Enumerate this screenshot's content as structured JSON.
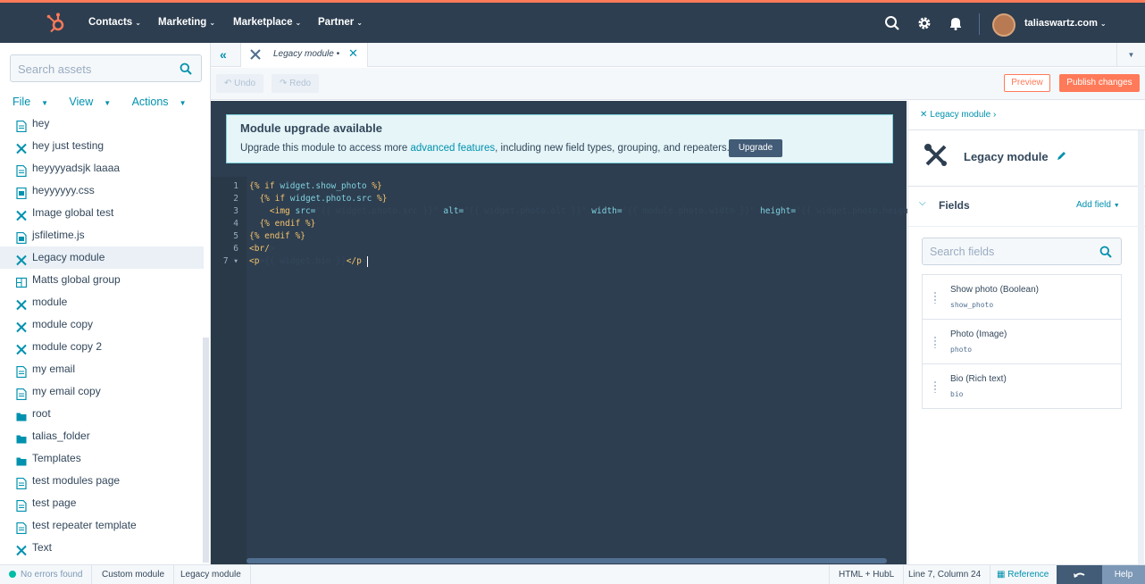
{
  "nav": {
    "items": [
      {
        "label": "Contacts"
      },
      {
        "label": "Marketing"
      },
      {
        "label": "Marketplace"
      },
      {
        "label": "Partner"
      }
    ],
    "account": "taliaswartz.com",
    "accent": "#ff7a59",
    "bg": "#2d3e50"
  },
  "sidebar": {
    "search_placeholder": "Search assets",
    "menus": [
      {
        "label": "File"
      },
      {
        "label": "View"
      },
      {
        "label": "Actions"
      }
    ],
    "assets": [
      {
        "label": "hey",
        "icon": "file-icon"
      },
      {
        "label": "hey just testing",
        "icon": "module-icon"
      },
      {
        "label": "heyyyyadsjk laaaa",
        "icon": "file-icon"
      },
      {
        "label": "heyyyyyy.css",
        "icon": "css-file-icon"
      },
      {
        "label": "Image global test",
        "icon": "module-icon"
      },
      {
        "label": "jsfiletime.js",
        "icon": "js-file-icon"
      },
      {
        "label": "Legacy module",
        "icon": "module-icon",
        "active": true
      },
      {
        "label": "Matts global group",
        "icon": "global-group-icon"
      },
      {
        "label": "module",
        "icon": "module-icon"
      },
      {
        "label": "module copy",
        "icon": "module-icon"
      },
      {
        "label": "module copy 2",
        "icon": "module-icon"
      },
      {
        "label": "my email",
        "icon": "file-icon"
      },
      {
        "label": "my email copy",
        "icon": "file-icon"
      },
      {
        "label": "root",
        "icon": "folder-icon"
      },
      {
        "label": "talias_folder",
        "icon": "folder-icon"
      },
      {
        "label": "Templates",
        "icon": "folder-icon"
      },
      {
        "label": "test modules page",
        "icon": "file-icon"
      },
      {
        "label": "test page",
        "icon": "file-icon"
      },
      {
        "label": "test repeater template",
        "icon": "file-icon"
      },
      {
        "label": "Text",
        "icon": "module-icon"
      }
    ]
  },
  "tabs": {
    "active_tab_label": "Legacy module  •"
  },
  "toolbar": {
    "undo_label": "Undo",
    "redo_label": "Redo",
    "preview_label": "Preview",
    "publish_label": "Publish changes"
  },
  "banner": {
    "title": "Module upgrade available",
    "text_before": "Upgrade this module to access more ",
    "link": "advanced features",
    "text_after": ", including new field types, grouping, and repeaters.",
    "button": "Upgrade"
  },
  "code": {
    "lines": [
      {
        "n": "1",
        "text": "{% if widget.show_photo %}"
      },
      {
        "n": "2",
        "text": "  {% if widget.photo.src %}"
      },
      {
        "n": "3",
        "text": "    <img src=\"{{ widget.photo.src }}\" alt=\"{{ widget.photo.alt }}\" width=\"{{ module.photo.width }}\" height=\"{{ widget.photo.height"
      },
      {
        "n": "4",
        "text": "  {% endif %}"
      },
      {
        "n": "5",
        "text": "{% endif %}"
      },
      {
        "n": "6",
        "text": "<br/>"
      },
      {
        "n": "7 ▾",
        "text": "<p>{{ widget.bio }}</p>"
      }
    ]
  },
  "rpanel": {
    "breadcrumb": "Legacy module ›",
    "module_title": "Legacy module",
    "fields_label": "Fields",
    "add_field_label": "Add field",
    "search_placeholder": "Search fields",
    "fields": [
      {
        "name": "Show photo (Boolean)",
        "id": "show_photo"
      },
      {
        "name": "Photo (Image)",
        "id": "photo"
      },
      {
        "name": "Bio (Rich text)",
        "id": "bio"
      }
    ]
  },
  "status": {
    "errors": "No errors found",
    "type": "Custom module",
    "name": "Legacy module",
    "language": "HTML + HubL",
    "position": "Line 7, Column 24",
    "reference": "Reference",
    "help": "Help"
  }
}
